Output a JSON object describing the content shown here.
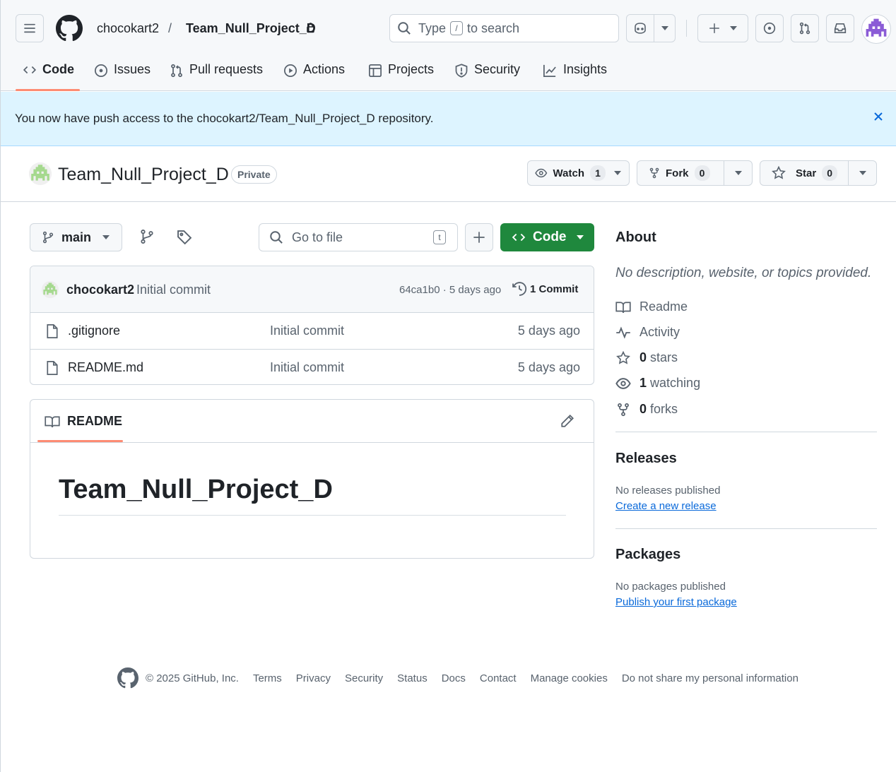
{
  "header": {
    "owner": "chocokart2",
    "separator": "/",
    "repo": "Team_Null_Project_D",
    "search": {
      "prefix": "Type",
      "key": "/",
      "suffix": "to search"
    }
  },
  "tabs": [
    {
      "label": "Code",
      "icon": "code-icon"
    },
    {
      "label": "Issues",
      "icon": "issue-icon"
    },
    {
      "label": "Pull requests",
      "icon": "pull-request-icon"
    },
    {
      "label": "Actions",
      "icon": "play-icon"
    },
    {
      "label": "Projects",
      "icon": "table-icon"
    },
    {
      "label": "Security",
      "icon": "shield-icon"
    },
    {
      "label": "Insights",
      "icon": "graph-icon"
    }
  ],
  "flash": {
    "message": "You now have push access to the chocokart2/Team_Null_Project_D repository."
  },
  "repo_header": {
    "title": "Team_Null_Project_D",
    "visibility": "Private",
    "watch": {
      "label": "Watch",
      "count": "1"
    },
    "fork": {
      "label": "Fork",
      "count": "0"
    },
    "star": {
      "label": "Star",
      "count": "0"
    }
  },
  "file_nav": {
    "branch": "main",
    "go_to_file": "Go to file",
    "go_to_file_key": "t",
    "code_button": "Code"
  },
  "latest_commit": {
    "author": "chocokart2",
    "message": "Initial commit",
    "meta": "64ca1b0 · 5 days ago",
    "commits": "1 Commit"
  },
  "files": [
    {
      "name": ".gitignore",
      "message": "Initial commit",
      "age": "5 days ago"
    },
    {
      "name": "README.md",
      "message": "Initial commit",
      "age": "5 days ago"
    }
  ],
  "readme": {
    "tab": "README",
    "heading": "Team_Null_Project_D"
  },
  "sidebar": {
    "about_title": "About",
    "about_desc": "No description, website, or topics provided.",
    "readme": "Readme",
    "activity": "Activity",
    "stars": {
      "count": "0",
      "label": "stars"
    },
    "watching": {
      "count": "1",
      "label": "watching"
    },
    "forks": {
      "count": "0",
      "label": "forks"
    },
    "releases_title": "Releases",
    "releases_none": "No releases published",
    "releases_link": "Create a new release",
    "packages_title": "Packages",
    "packages_none": "No packages published",
    "packages_link": "Publish your first package"
  },
  "footer": {
    "copyright": "© 2025 GitHub, Inc.",
    "links": [
      "Terms",
      "Privacy",
      "Security",
      "Status",
      "Docs",
      "Contact",
      "Manage cookies",
      "Do not share my personal information"
    ]
  },
  "colors": {
    "accent": "#0969da",
    "green": "#1f883d",
    "tab_underline": "#fd8c73",
    "flash_bg": "#ddf4ff"
  }
}
